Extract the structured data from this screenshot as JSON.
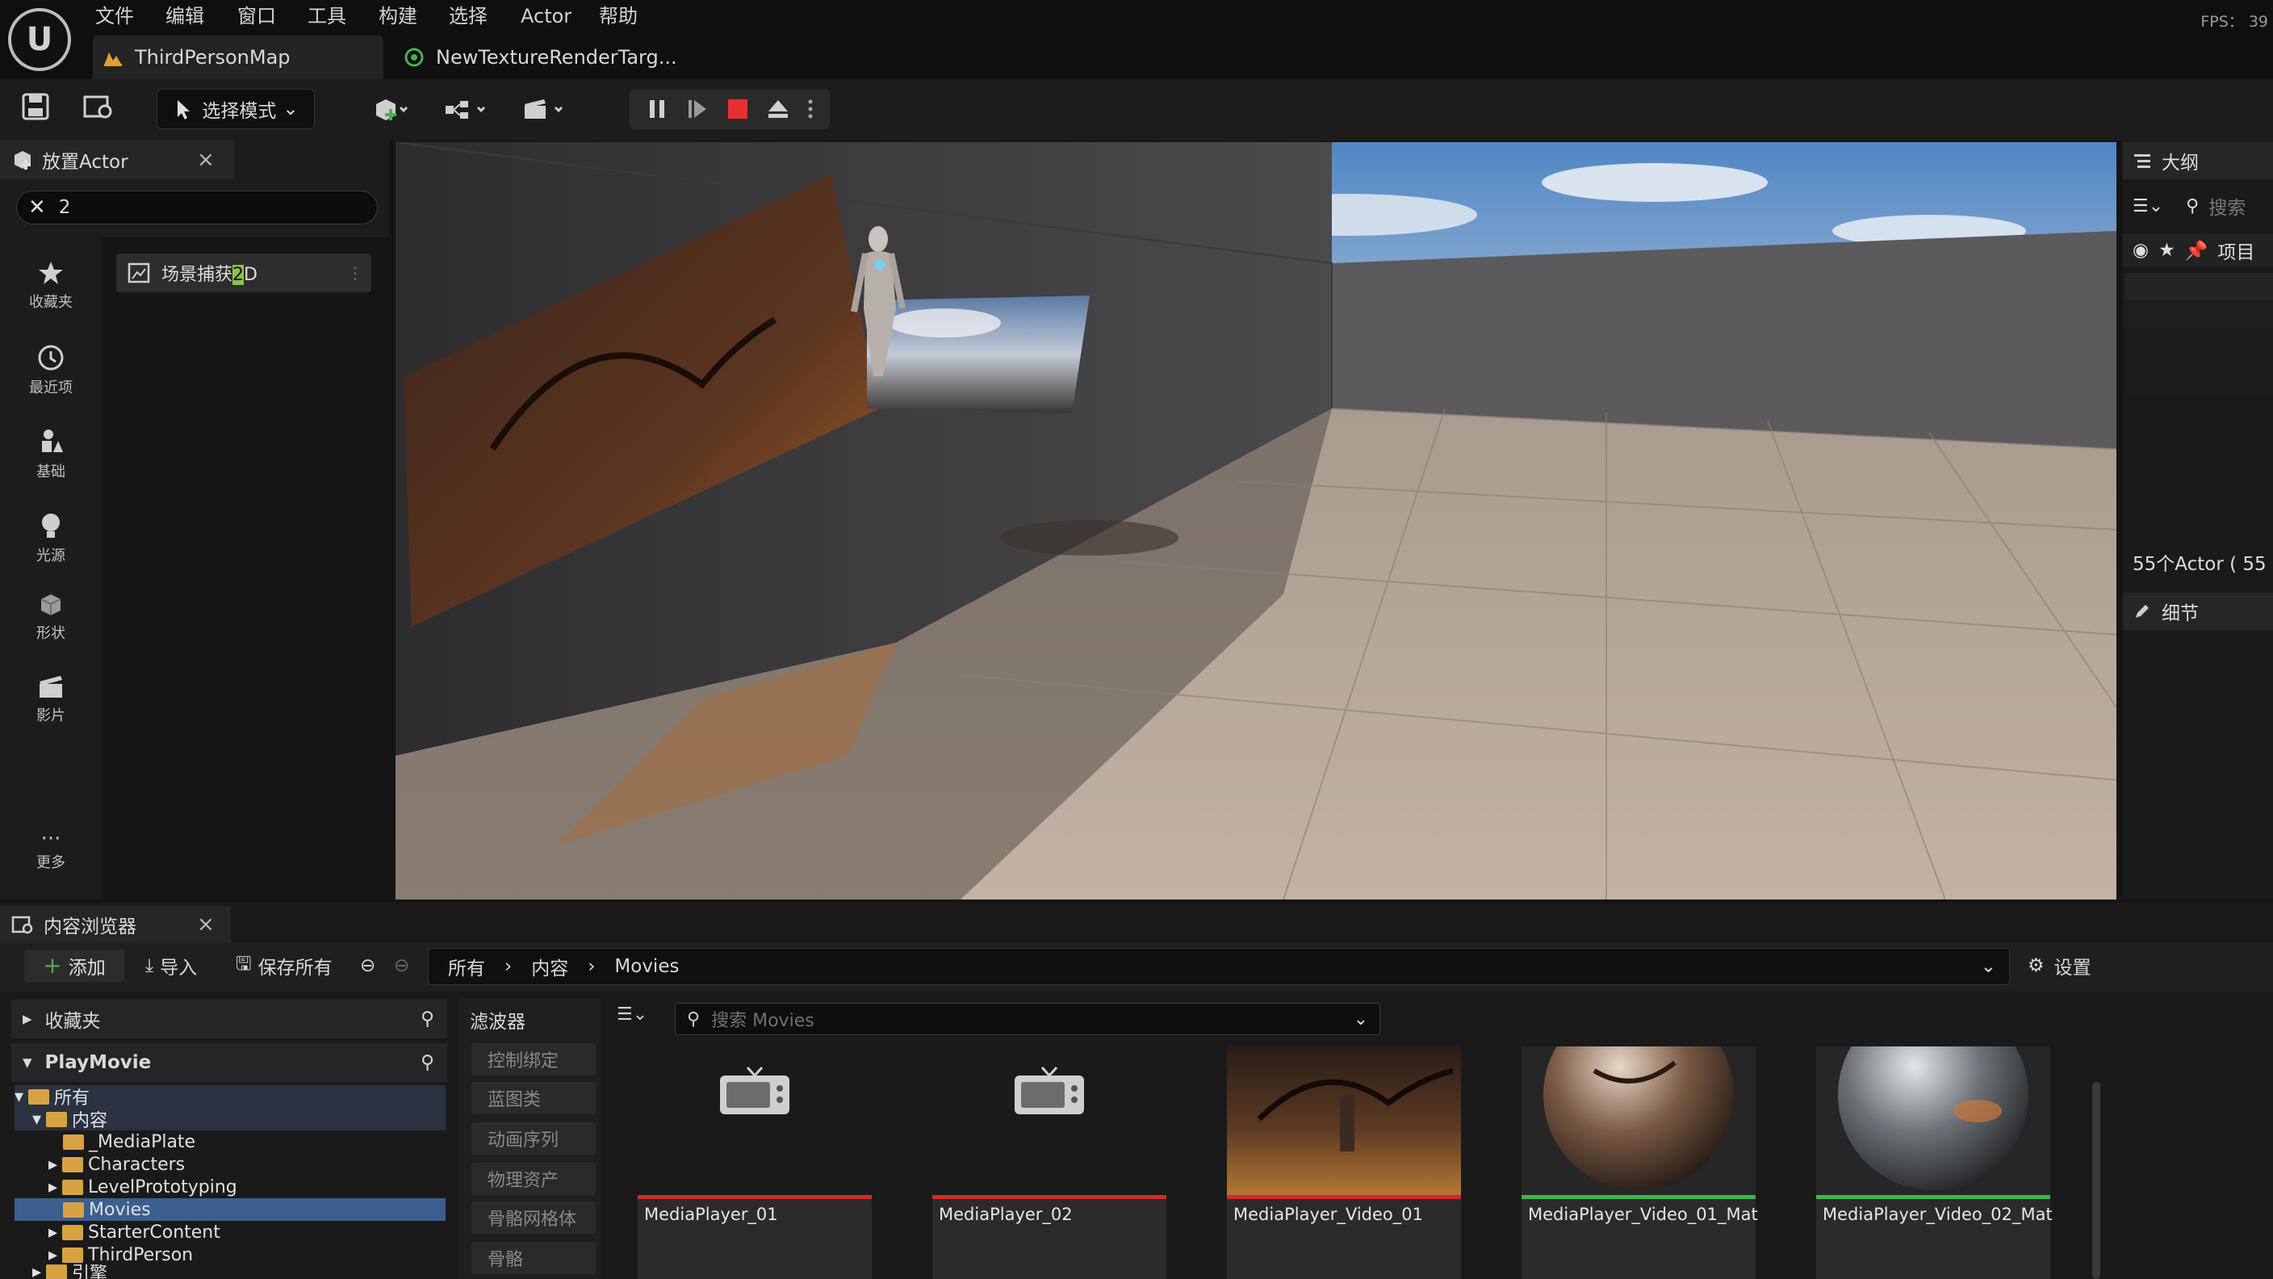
{
  "app": {
    "logo": "U",
    "fps_label": "FPS： 39"
  },
  "menu": [
    "文件",
    "编辑",
    "窗口",
    "工具",
    "构建",
    "选择",
    "Actor",
    "帮助"
  ],
  "tabs": [
    {
      "label": "ThirdPersonMap",
      "icon": "level-icon"
    },
    {
      "label": "NewTextureRenderTarg...",
      "icon": "render-target-icon"
    }
  ],
  "toolbar": {
    "mode_label": "选择模式"
  },
  "place_actor": {
    "title": "放置Actor",
    "search_value": "2",
    "categories": [
      "收藏夹",
      "最近项",
      "基础",
      "光源",
      "形状",
      "影片",
      "更多"
    ],
    "result_prefix": "场景捕获",
    "result_highlight": "2",
    "result_suffix": "D"
  },
  "outliner": {
    "title": "大纲",
    "search_placeholder": "搜索",
    "column_label": "项目",
    "actor_count": "55个Actor ( 55",
    "details_title": "细节"
  },
  "content_browser": {
    "title": "内容浏览器",
    "add_label": "添加",
    "import_label": "导入",
    "save_all_label": "保存所有",
    "breadcrumb": [
      "所有",
      "内容",
      "Movies"
    ],
    "settings_label": "设置",
    "favorites_label": "收藏夹",
    "project_label": "PlayMovie",
    "tree": [
      "所有",
      "内容",
      "_MediaPlate",
      "Characters",
      "LevelPrototyping",
      "Movies",
      "StarterContent",
      "ThirdPerson",
      "引擎"
    ],
    "filters_title": "滤波器",
    "filters": [
      "控制绑定",
      "蓝图类",
      "动画序列",
      "物理资产",
      "骨骼网格体",
      "骨骼"
    ],
    "search_placeholder": "搜索 Movies",
    "assets": [
      {
        "name": "MediaPlayer_01",
        "type_color": "#d42a2a",
        "thumb": "tv-icon"
      },
      {
        "name": "MediaPlayer_02",
        "type_color": "#d42a2a",
        "thumb": "tv-icon"
      },
      {
        "name": "MediaPlayer_Video_01",
        "type_color": "#d42a2a",
        "thumb": "video-frame"
      },
      {
        "name": "MediaPlayer_Video_01_Mat",
        "type_color": "#3fb34f",
        "thumb": "material-sphere"
      },
      {
        "name": "MediaPlayer_Video_02_Mat",
        "type_color": "#3fb34f",
        "thumb": "material-sphere"
      }
    ]
  }
}
